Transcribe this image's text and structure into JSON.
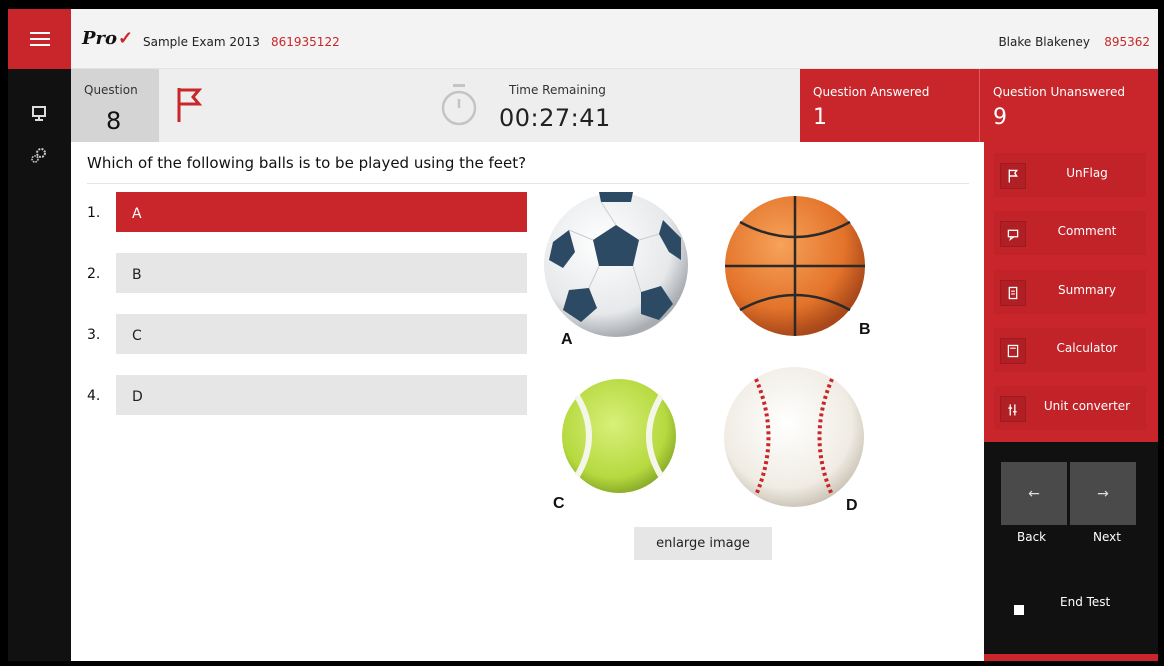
{
  "header": {
    "logo": "Pro",
    "exam_title": "Sample Exam 2013",
    "exam_code": "861935122",
    "user_name": "Blake Blakeney",
    "user_id": "895362"
  },
  "status": {
    "question_label": "Question",
    "question_number": "8",
    "time_label": "Time Remaining",
    "time_value": "00:27:41",
    "answered_label": "Question Answered",
    "answered_count": "1",
    "unanswered_label": "Question Unanswered",
    "unanswered_count": "9"
  },
  "question": {
    "text": "Which of the following balls is to be played using the feet?",
    "options": [
      {
        "number": "1.",
        "label": "A",
        "selected": true
      },
      {
        "number": "2.",
        "label": "B",
        "selected": false
      },
      {
        "number": "3.",
        "label": "C",
        "selected": false
      },
      {
        "number": "4.",
        "label": "D",
        "selected": false
      }
    ],
    "image_letters": [
      "A",
      "B",
      "C",
      "D"
    ],
    "enlarge_label": "enlarge image"
  },
  "sidebar": {
    "buttons": [
      {
        "label": "UnFlag",
        "icon": "flag-icon"
      },
      {
        "label": "Comment",
        "icon": "comment-icon"
      },
      {
        "label": "Summary",
        "icon": "summary-icon"
      },
      {
        "label": "Calculator",
        "icon": "calculator-icon"
      },
      {
        "label": "Unit converter",
        "icon": "unit-converter-icon"
      }
    ],
    "back_label": "Back",
    "next_label": "Next",
    "back_arrow": "←",
    "next_arrow": "→",
    "end_test_label": "End Test"
  },
  "colors": {
    "accent": "#c8262b",
    "dark": "#111111",
    "panel_grey": "#e6e6e6"
  }
}
